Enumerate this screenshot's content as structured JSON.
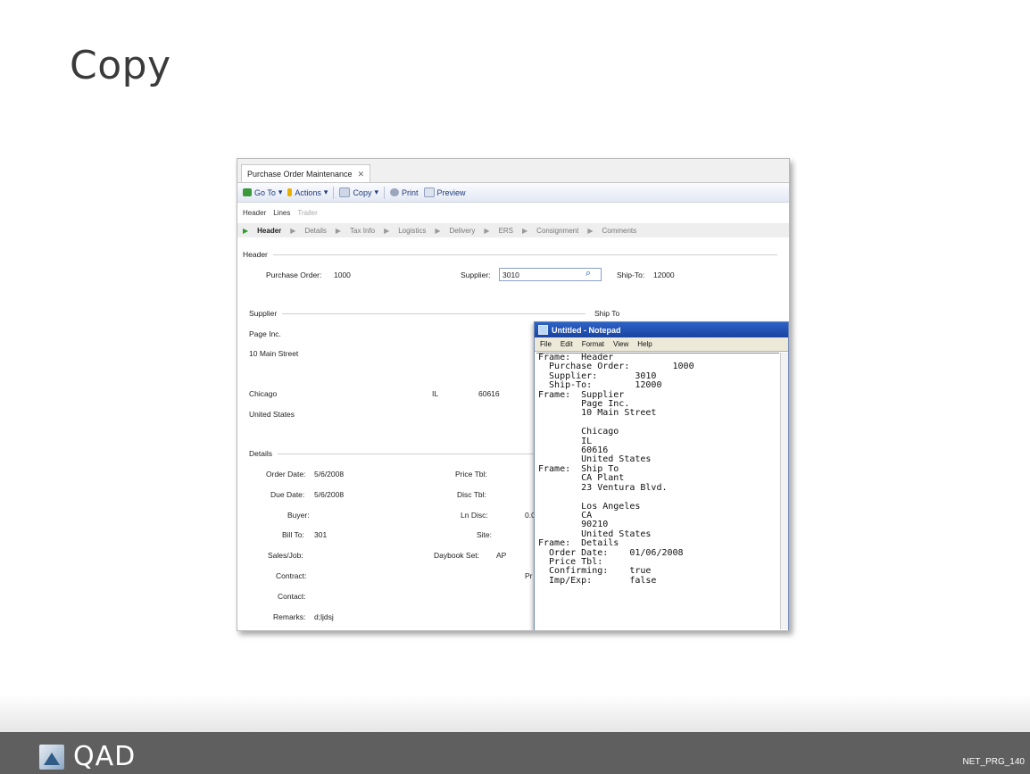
{
  "slide": {
    "title": "Copy",
    "footer_code": "NET_PRG_140",
    "logo_text": "QAD"
  },
  "app": {
    "tab_label": "Purchase Order Maintenance",
    "toolbar": {
      "goto": "Go To",
      "actions": "Actions",
      "copy": "Copy",
      "print": "Print",
      "preview": "Preview"
    },
    "subtabs": [
      "Header",
      "Lines",
      "Trailer"
    ],
    "breadcrumb": [
      "Header",
      "Details",
      "Tax Info",
      "Logistics",
      "Delivery",
      "ERS",
      "Consignment",
      "Comments"
    ],
    "header_section": "Header",
    "fields": {
      "po_label": "Purchase Order:",
      "po_value": "1000",
      "supplier_label": "Supplier:",
      "supplier_value": "3010",
      "shipto_label": "Ship-To:",
      "shipto_value": "12000"
    },
    "supplier_section": "Supplier",
    "shipto_section": "Ship To",
    "supplier_addr": {
      "name": "Page Inc.",
      "street": "10 Main Street",
      "city": "Chicago",
      "state": "IL",
      "zip": "60616",
      "country": "United States"
    },
    "details_section": "Details",
    "details": {
      "order_date_label": "Order Date:",
      "order_date_value": "5/6/2008",
      "due_date_label": "Due Date:",
      "due_date_value": "5/6/2008",
      "buyer_label": "Buyer:",
      "bill_to_label": "Bill To:",
      "bill_to_value": "301",
      "sales_job_label": "Sales/Job:",
      "contract_label": "Contract:",
      "contact_label": "Contact:",
      "remarks_label": "Remarks:",
      "remarks_value": "d;ljdsj",
      "price_tbl_label": "Price Tbl:",
      "disc_tbl_label": "Disc Tbl:",
      "ln_disc_label": "Ln Disc:",
      "ln_disc_value": "0.0",
      "site_label": "Site:",
      "daybook_label": "Daybook Set:",
      "daybook_value": "AP",
      "pr_label": "Pr"
    }
  },
  "notepad": {
    "title": "Untitled - Notepad",
    "menu": [
      "File",
      "Edit",
      "Format",
      "View",
      "Help"
    ],
    "text": "Frame:  Header\n  Purchase Order:        1000\n  Supplier:       3010\n  Ship-To:        12000\nFrame:  Supplier\n        Page Inc.\n        10 Main Street\n\n        Chicago\n        IL\n        60616\n        United States\nFrame:  Ship To\n        CA Plant\n        23 Ventura Blvd.\n\n        Los Angeles\n        CA\n        90210\n        United States\nFrame:  Details\n  Order Date:    01/06/2008\n  Price Tbl:\n  Confirming:    true\n  Imp/Exp:       false"
  }
}
